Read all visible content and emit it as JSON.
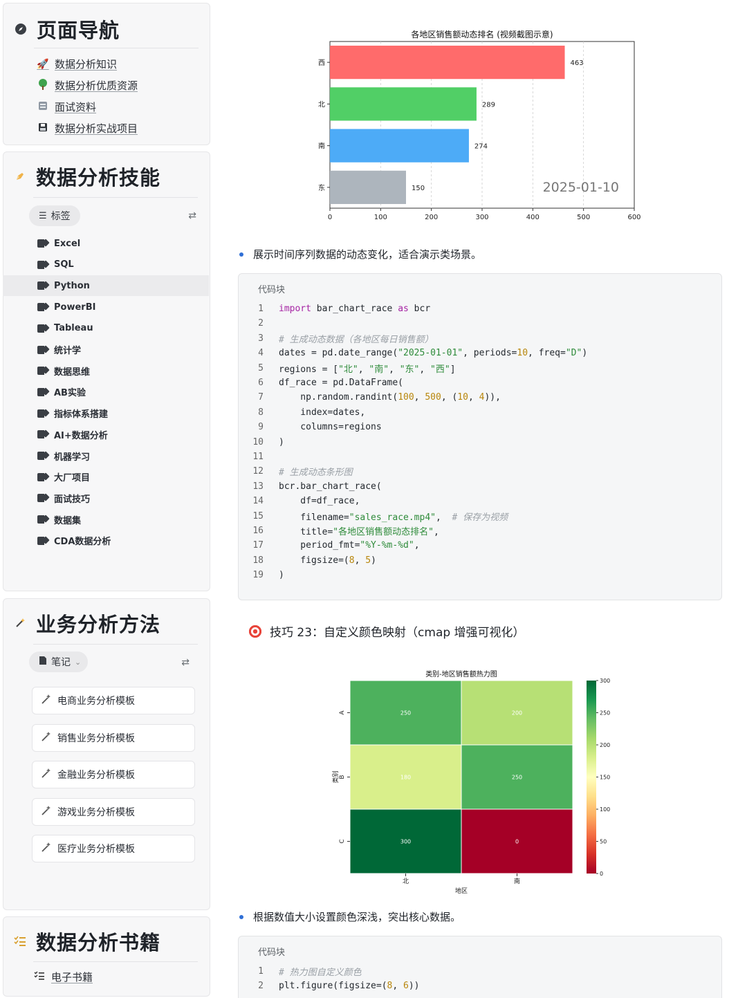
{
  "sidebar": {
    "nav": {
      "title": "页面导航",
      "items": [
        {
          "label": "数据分析知识",
          "icon": "rocket-icon"
        },
        {
          "label": "数据分析优质资源",
          "icon": "tree-icon"
        },
        {
          "label": "面试资料",
          "icon": "cabinet-icon"
        },
        {
          "label": "数据分析实战项目",
          "icon": "floppy-icon"
        }
      ]
    },
    "skills": {
      "title": "数据分析技能",
      "chip_label": "标签",
      "tags": [
        "Excel",
        "SQL",
        "Python",
        "PowerBI",
        "Tableau",
        "统计学",
        "数据思维",
        "AB实验",
        "指标体系搭建",
        "AI+数据分析",
        "机器学习",
        "大厂项目",
        "面试技巧",
        "数据集",
        "CDA数据分析"
      ],
      "active_tag": "Python"
    },
    "business": {
      "title": "业务分析方法",
      "chip_label": "笔记",
      "templates": [
        "电商业务分析模板",
        "销售业务分析模板",
        "金融业务分析模板",
        "游戏业务分析模板",
        "医疗业务分析模板"
      ]
    },
    "books": {
      "title": "数据分析书籍",
      "items": [
        "电子书籍"
      ]
    }
  },
  "main": {
    "bullet1": "展示时间序列数据的动态变化，适合演示类场景。",
    "code1": {
      "header": "代码块",
      "lines": [
        "import bar_chart_race as bcr",
        "",
        "# 生成动态数据（各地区每日销售额）",
        "dates = pd.date_range(\"2025-01-01\", periods=10, freq=\"D\")",
        "regions = [\"北\", \"南\", \"东\", \"西\"]",
        "df_race = pd.DataFrame(",
        "    np.random.randint(100, 500, (10, 4)),",
        "    index=dates,",
        "    columns=regions",
        ")",
        "",
        "# 生成动态条形图",
        "bcr.bar_chart_race(",
        "    df=df_race,",
        "    filename=\"sales_race.mp4\",  # 保存为视频",
        "    title=\"各地区销售额动态排名\",",
        "    period_fmt=\"%Y-%m-%d\",",
        "    figsize=(8, 5)",
        ")"
      ]
    },
    "tip_heading": "技巧 23：自定义颜色映射（cmap 增强可视化）",
    "bullet2": "根据数值大小设置颜色深浅，突出核心数据。",
    "code2": {
      "header": "代码块",
      "lines": [
        "# 热力图自定义颜色",
        "plt.figure(figsize=(8, 6))"
      ]
    }
  },
  "chart_data": [
    {
      "type": "bar",
      "orientation": "horizontal",
      "title": "各地区销售额动态排名 (视频截图示意)",
      "categories": [
        "西",
        "北",
        "南",
        "东"
      ],
      "values": [
        463,
        289,
        274,
        150
      ],
      "colors": [
        "#ff6b6b",
        "#51cf66",
        "#4dabf7",
        "#adb5bd"
      ],
      "xlim": [
        0,
        600
      ],
      "xticks": [
        0,
        100,
        200,
        300,
        400,
        500,
        600
      ],
      "period_label": "2025-01-10",
      "grid": "x-dashed"
    },
    {
      "type": "heatmap",
      "title": "类别-地区销售额热力图",
      "xlabel": "地区",
      "ylabel": "类别",
      "x": [
        "北",
        "南"
      ],
      "y": [
        "A",
        "B",
        "C"
      ],
      "values": [
        [
          250,
          200
        ],
        [
          180,
          250
        ],
        [
          300,
          0
        ]
      ],
      "cmap": "RdYlGn",
      "colorbar_range": [
        0,
        300
      ],
      "colorbar_ticks": [
        0,
        50,
        100,
        150,
        200,
        250,
        300
      ]
    }
  ]
}
